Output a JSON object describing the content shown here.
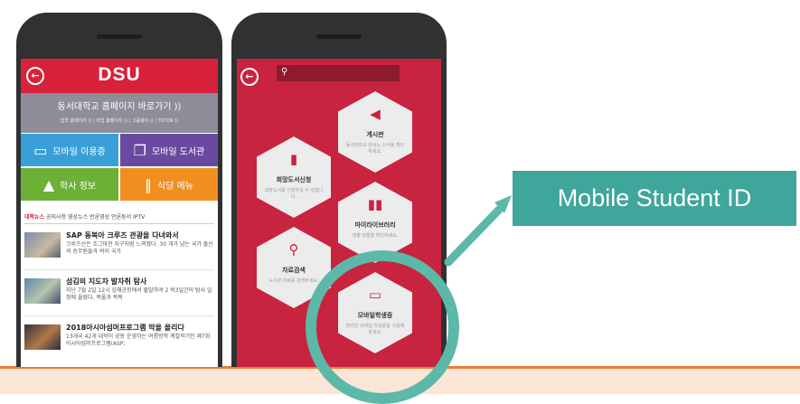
{
  "phone1": {
    "logo": "DSU",
    "back_glyph": "←",
    "home_link_title": "동서대학교 홈페이지 바로가기 ))",
    "home_link_sublinks": "입학 홈페이지 )) | 취업 홈페이지 )) | 그룹웨어 )) | TUTOR ))",
    "tiles": [
      {
        "icon": "id-card-icon",
        "glyph": "▭",
        "label": "모바일 이용증"
      },
      {
        "icon": "book-icon",
        "glyph": "❐",
        "label": "모바일 도서관"
      },
      {
        "icon": "graduation-cap-icon",
        "glyph": "▲",
        "label": "학사 정보"
      },
      {
        "icon": "fork-knife-icon",
        "glyph": "‖",
        "label": "식당 메뉴"
      }
    ],
    "news_tabs": [
      "대학뉴스",
      "공지사항",
      "영상뉴스",
      "언론영상",
      "언론동서",
      "IPTV"
    ],
    "news": [
      {
        "title": "SAP 동북아 크루즈 관광을 다녀와서",
        "desc": "크루즈선은 조그마한 지구처럼 느껴졌다. 30 개가 넘는 국가 출신의 승무원들과 여러 국가"
      },
      {
        "title": "섬김의 지도자 발자취 탐사",
        "desc": "지난 7월 2일 12시 김해공항에서 출발하여 2 박3일간의 탐사 일정에 올랐다. 목풀과 목목"
      },
      {
        "title": "2018아시아섬머프로그램 막을 올리다",
        "desc": "13개국 42개 대학이 공동 운영하는 여름방학 계절학기인 제7회 아시아섬머프로그램(ASP;"
      }
    ]
  },
  "phone2": {
    "back_glyph": "←",
    "search_glyph": "⚲",
    "hexes": [
      {
        "icon": "megaphone-icon",
        "glyph": "◀",
        "name": "게시판",
        "desc": "동서대학교 안내는 소식을 확인하세요."
      },
      {
        "icon": "book-icon",
        "glyph": "▮",
        "name": "희망도서신청",
        "desc": "희망도서를 신청하실 수 있습니다."
      },
      {
        "icon": "books-icon",
        "glyph": "▮▮",
        "name": "마이라이브러리",
        "desc": "대출 현황을 확인하세요."
      },
      {
        "icon": "search-icon",
        "glyph": "⚲",
        "name": "자료검색",
        "desc": "도서관 자료를 검색하세요."
      },
      {
        "icon": "card-icon",
        "glyph": "▭",
        "name": "모바일학생증",
        "desc": "편리한 모바일 학생증을 사용해 보세요."
      }
    ]
  },
  "callout": {
    "label": "Mobile Student ID"
  },
  "colors": {
    "dsu_red": "#d8213a",
    "library_red": "#c8233f",
    "callout_teal": "#3fa69b",
    "highlight_ring": "#5cb8a8",
    "bottom_bar": "#fbe5d6"
  }
}
